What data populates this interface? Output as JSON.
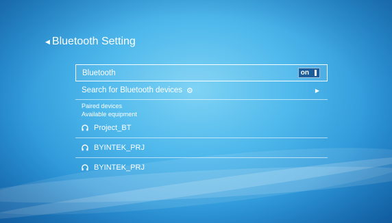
{
  "header": {
    "back_icon": "chevron-left-icon",
    "title": "Bluetooth Setting"
  },
  "bluetooth_row": {
    "label": "Bluetooth",
    "toggle_label": "on",
    "state": "on"
  },
  "search_row": {
    "label": "Search for Bluetooth devices",
    "icon": "gear-icon",
    "arrow": "chevron-right-icon"
  },
  "paired_devices_label": "Paired devices",
  "available_equipment_label": "Available equipment",
  "devices": [
    {
      "name": "Project_BT",
      "icon": "headphones-icon"
    },
    {
      "name": "BYINTEK_PRJ",
      "icon": "headphones-icon"
    },
    {
      "name": "BYINTEK_PRJ",
      "icon": "headphones-icon"
    }
  ]
}
